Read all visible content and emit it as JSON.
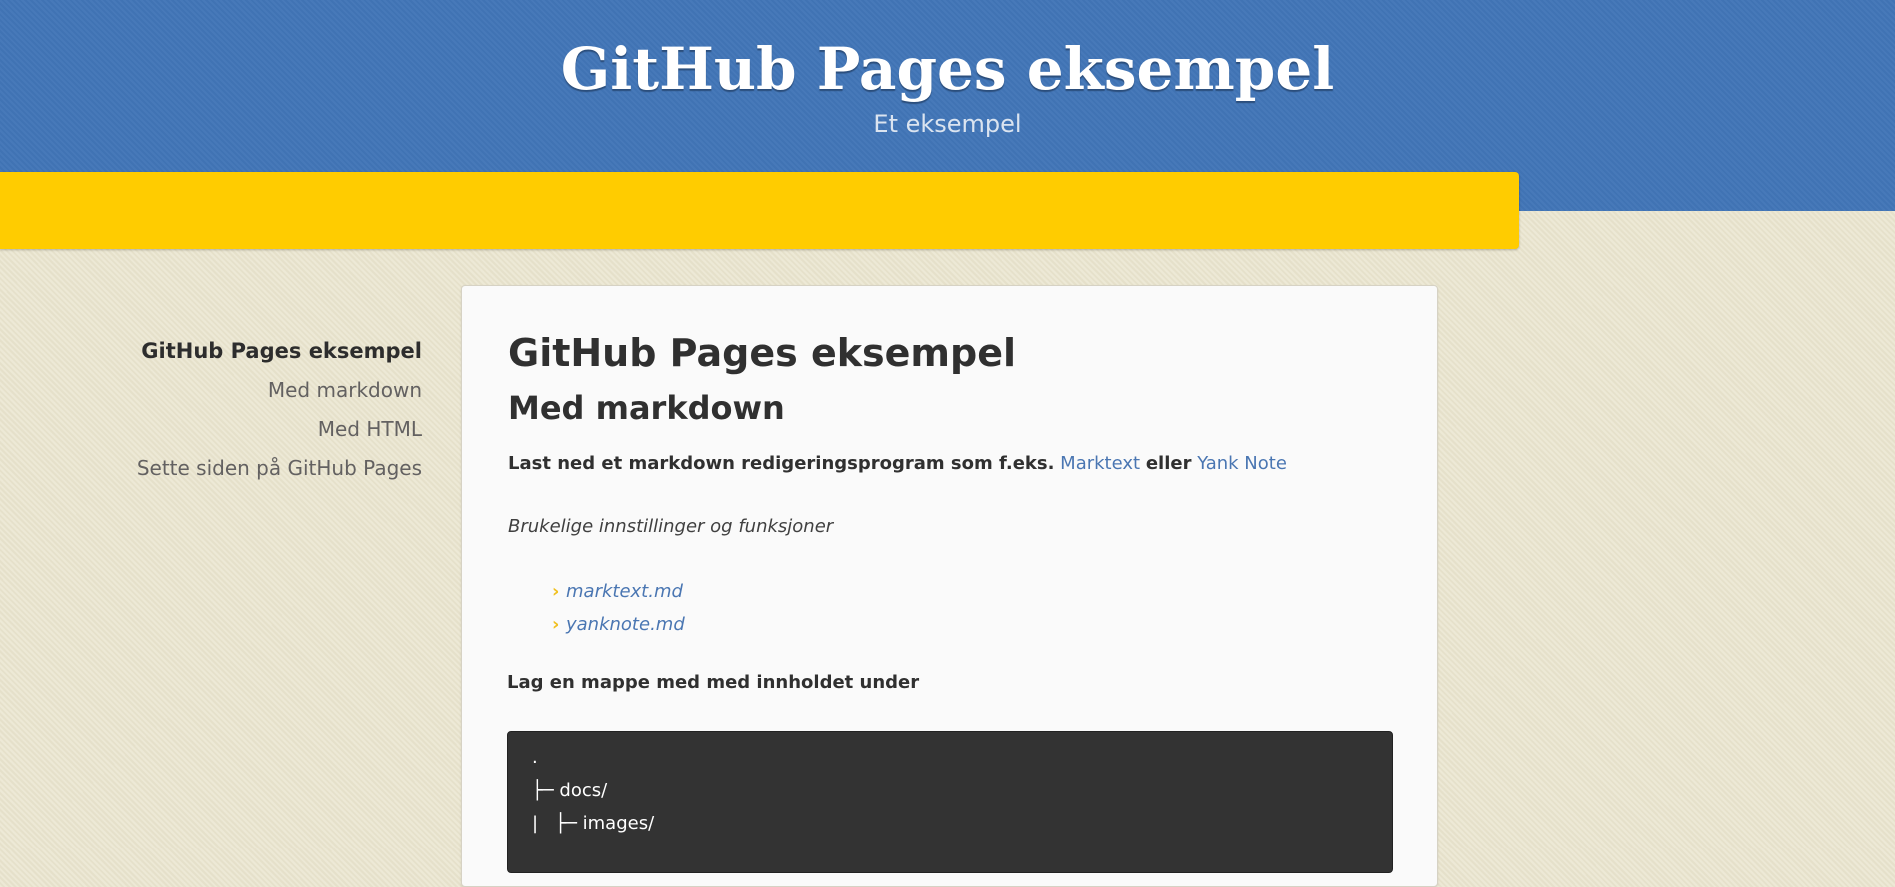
{
  "header": {
    "title": "GitHub Pages eksempel",
    "subtitle": "Et eksempel"
  },
  "sidebar": {
    "items": [
      {
        "label": "GitHub Pages eksempel",
        "active": true
      },
      {
        "label": "Med markdown",
        "active": false
      },
      {
        "label": "Med HTML",
        "active": false
      },
      {
        "label": "Sette siden på GitHub Pages",
        "active": false
      }
    ]
  },
  "main": {
    "h1": "GitHub Pages eksempel",
    "h2": "Med markdown",
    "intro": {
      "text": "Last ned et markdown redigeringsprogram som f.eks.",
      "link1": "Marktext",
      "between": "eller",
      "link2": "Yank Note"
    },
    "tips": "Brukelige innstillinger og funksjoner",
    "files": [
      {
        "label": "marktext.md"
      },
      {
        "label": "yanknote.md"
      }
    ],
    "folder_intro": "Lag en mappe med med innholdet under",
    "code_lines": [
      ".",
      "├─ docs/",
      "|   ├─ images/"
    ]
  },
  "colors": {
    "header_bg": "#4175b7",
    "accent_bar": "#ffcc00",
    "page_bg": "#e9e4cd",
    "link": "#4a76b2",
    "code_bg": "#333333"
  }
}
